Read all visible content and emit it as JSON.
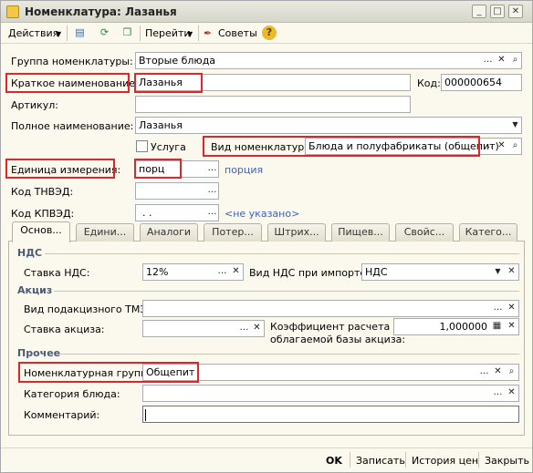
{
  "window": {
    "title": "Номенклатура: Лазанья"
  },
  "toolbar": {
    "actions_label": "Действия",
    "goto_label": "Перейти",
    "tips_label": "Советы"
  },
  "form": {
    "group": {
      "label": "Группа номенклатуры:",
      "value": "Вторые блюда"
    },
    "short_name": {
      "label": "Краткое наименование:",
      "value": "Лазанья"
    },
    "code": {
      "label": "Код:",
      "value": "000000654"
    },
    "article": {
      "label": "Артикул:",
      "value": ""
    },
    "full_name": {
      "label": "Полное наименование:",
      "value": "Лазанья"
    },
    "service": {
      "label": "Услуга",
      "checked": false
    },
    "item_kind": {
      "label": "Вид номенклатуры:",
      "value": "Блюда и полуфабрикаты (общепит)"
    },
    "unit": {
      "label": "Единица измерения:",
      "value": "порц",
      "hint": "порция"
    },
    "tnved": {
      "label": "Код ТНВЭД:",
      "value": ""
    },
    "kpved": {
      "label": "Код КПВЭД:",
      "value": ". .",
      "hint": "<не указано>"
    }
  },
  "tabs": [
    "Основ...",
    "Едини...",
    "Аналоги",
    "Потер...",
    "Штрих...",
    "Пищев...",
    "Свойс...",
    "Катего..."
  ],
  "panel": {
    "vat_section": "НДС",
    "vat_rate": {
      "label": "Ставка НДС:",
      "value": "12%"
    },
    "vat_import": {
      "label": "Вид НДС при импорте:",
      "value": "НДС"
    },
    "excise_section": "Акциз",
    "excise_tmz": {
      "label": "Вид подакцизного ТМЗ:",
      "value": ""
    },
    "excise_rate": {
      "label": "Ставка акциза:",
      "value": ""
    },
    "coef_label_line1": "Коэффициент расчета",
    "coef_label_line2": "облагаемой базы акциза:",
    "coef_value": "1,000000",
    "other_section": "Прочее",
    "nom_group": {
      "label": "Номенклатурная группа:",
      "value": "Общепит"
    },
    "dish_category": {
      "label": "Категория блюда:",
      "value": ""
    },
    "comment": {
      "label": "Комментарий:",
      "value": ""
    }
  },
  "bottom": {
    "ok": "OK",
    "save": "Записать",
    "price_history": "История цен",
    "close": "Закрыть"
  },
  "colors": {
    "highlight": "#e0262a",
    "link": "#3d63b5",
    "section": "#4a5a78"
  },
  "icons": [
    "window-icon",
    "minimize-icon",
    "maximize-icon",
    "close-icon",
    "help-icon",
    "select-icon",
    "clear-icon",
    "search-icon",
    "dropdown-icon",
    "calculator-icon"
  ]
}
